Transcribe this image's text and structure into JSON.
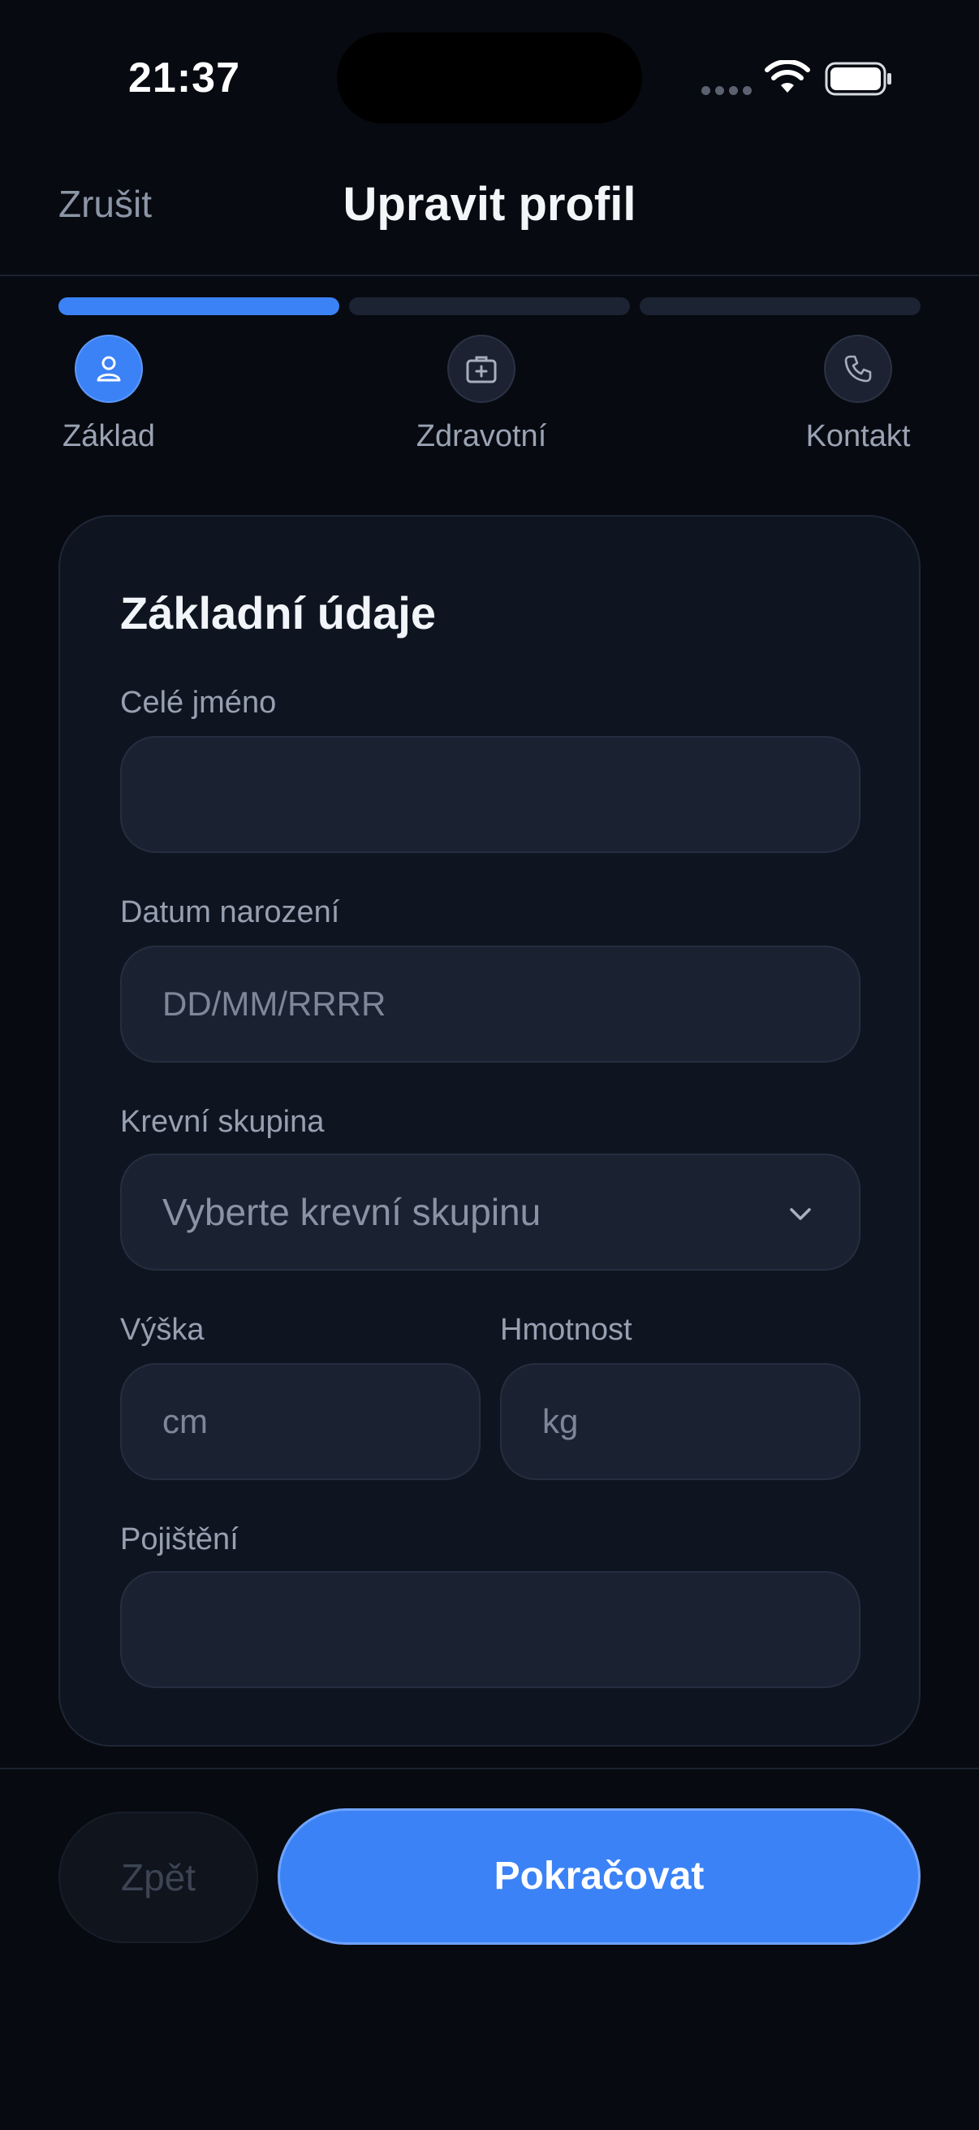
{
  "status_bar": {
    "time": "21:37"
  },
  "header": {
    "cancel_label": "Zrušit",
    "title": "Upravit profil"
  },
  "progress": {
    "current_step": 1,
    "total_steps": 3
  },
  "steps": [
    {
      "label": "Základ",
      "icon": "user-icon",
      "active": true
    },
    {
      "label": "Zdravotní",
      "icon": "medical-kit-icon",
      "active": false
    },
    {
      "label": "Kontakt",
      "icon": "phone-icon",
      "active": false
    }
  ],
  "form": {
    "title": "Základní údaje",
    "full_name": {
      "label": "Celé jméno",
      "value": "",
      "placeholder": ""
    },
    "birth_date": {
      "label": "Datum narození",
      "placeholder": "DD/MM/RRRR"
    },
    "blood_type": {
      "label": "Krevní skupina",
      "placeholder": "Vyberte krevní skupinu"
    },
    "height": {
      "label": "Výška",
      "placeholder": "cm"
    },
    "weight": {
      "label": "Hmotnost",
      "placeholder": "kg"
    },
    "insurance": {
      "label": "Pojištění",
      "value": ""
    }
  },
  "footer": {
    "back_label": "Zpět",
    "continue_label": "Pokračovat"
  },
  "colors": {
    "accent": "#3b82f6",
    "background": "#070a10",
    "card": "#0f1520",
    "input": "#1a2130"
  }
}
